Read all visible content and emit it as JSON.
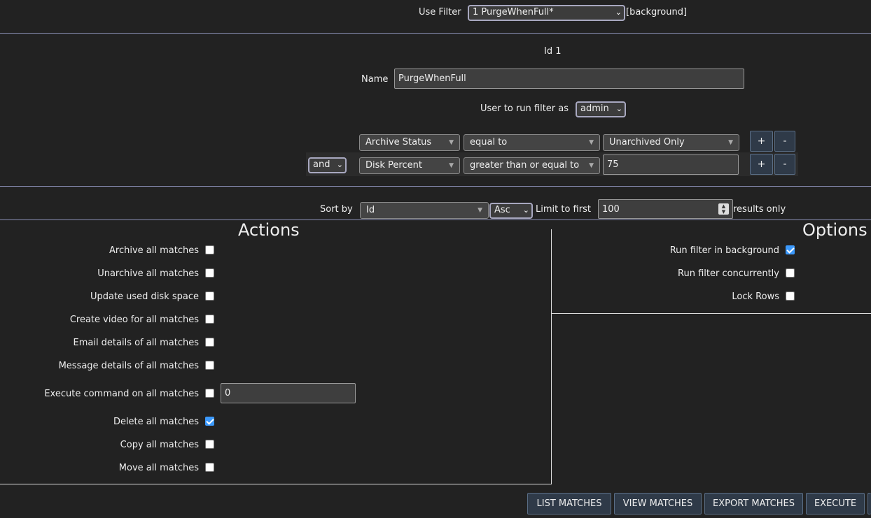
{
  "filter": {
    "use_filter_label": "Use Filter",
    "selected": "1 PurgeWhenFull*",
    "background_tag": "[background]"
  },
  "details": {
    "id_text": "Id 1",
    "name_label": "Name",
    "name_value": "PurgeWhenFull",
    "user_label": "User to run filter as",
    "user_value": "admin"
  },
  "terms": [
    {
      "conjunction": "",
      "attribute": "Archive Status",
      "operator": "equal to",
      "value": "Unarchived Only",
      "value_kind": "select"
    },
    {
      "conjunction": "and",
      "attribute": "Disk Percent",
      "operator": "greater than or equal to",
      "value": "75",
      "value_kind": "text"
    }
  ],
  "term_buttons": {
    "add": "+",
    "remove": "-"
  },
  "sort": {
    "sort_by_label": "Sort by",
    "field": "Id",
    "direction": "Asc",
    "limit_label": "Limit to first",
    "limit_value": "100",
    "results_label": "results only"
  },
  "actions": {
    "heading": "Actions",
    "items": [
      {
        "label": "Archive all matches",
        "checked": false
      },
      {
        "label": "Unarchive all matches",
        "checked": false
      },
      {
        "label": "Update used disk space",
        "checked": false
      },
      {
        "label": "Create video for all matches",
        "checked": false
      },
      {
        "label": "Email details of all matches",
        "checked": false
      },
      {
        "label": "Message details of all matches",
        "checked": false
      },
      {
        "label": "Execute command on all matches",
        "checked": false,
        "input_value": "0"
      },
      {
        "label": "Delete all matches",
        "checked": true
      },
      {
        "label": "Copy all matches",
        "checked": false
      },
      {
        "label": "Move all matches",
        "checked": false
      }
    ]
  },
  "options": {
    "heading": "Options",
    "items": [
      {
        "label": "Run filter in background",
        "checked": true
      },
      {
        "label": "Run filter concurrently",
        "checked": false
      },
      {
        "label": "Lock Rows",
        "checked": false
      }
    ]
  },
  "footer": {
    "buttons": [
      "LIST MATCHES",
      "VIEW MATCHES",
      "EXPORT MATCHES",
      "EXECUTE"
    ]
  },
  "colors": {
    "background": "#222222",
    "button_bg": "#2f3a48",
    "checkbox_checked": "#3b99fc",
    "divider": "#8a8fb5"
  }
}
